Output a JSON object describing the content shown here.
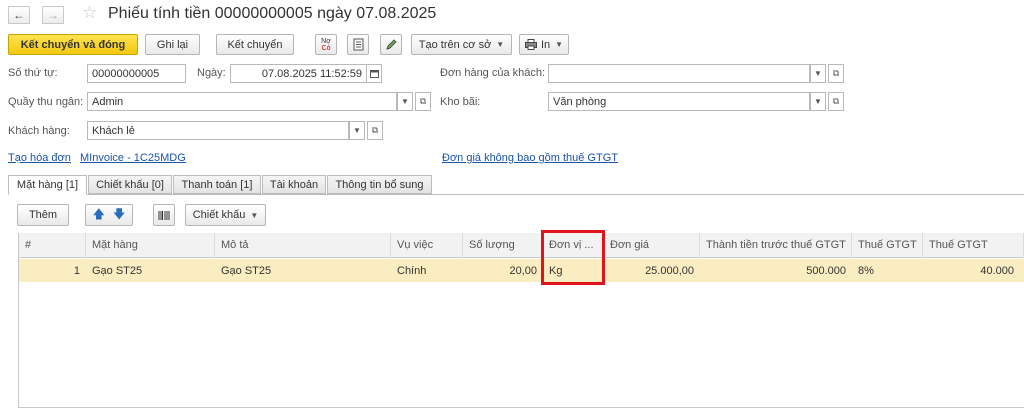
{
  "window": {
    "title": "Phiếu tính tiền 00000000005 ngày 07.08.2025",
    "back_icon": "arrow-left-icon",
    "forward_icon": "arrow-right-icon",
    "favorite_icon": "star-icon"
  },
  "toolbar": {
    "post_close_label": "Kết chuyển và đóng",
    "save_label": "Ghi lại",
    "post_label": "Kết chuyển",
    "create_based_label": "Tạo trên cơ sở",
    "print_label": "In",
    "icon_nc_text": "Nợ",
    "icon_nc_text2": "Có"
  },
  "form": {
    "number_label": "Số thứ tự:",
    "number_value": "00000000005",
    "date_label": "Ngày:",
    "date_value": "07.08.2025 11:52:59",
    "customer_order_label": "Đơn hàng của khách:",
    "customer_order_value": "",
    "cashier_label": "Quầy thu ngân:",
    "cashier_value": "Admin",
    "warehouse_label": "Kho bãi:",
    "warehouse_value": "Văn phòng",
    "customer_label": "Khách hàng:",
    "customer_value": "Khách lẻ",
    "create_invoice_link": "Tạo hóa đơn",
    "minvoice_link": "MInvoice - 1C25MDG",
    "price_vat_link": "Đơn giá không bao gồm thuế GTGT"
  },
  "tabs": [
    {
      "label": "Mặt hàng [1]",
      "active": true
    },
    {
      "label": "Chiết khấu [0]",
      "active": false
    },
    {
      "label": "Thanh toán [1]",
      "active": false
    },
    {
      "label": "Tài khoản",
      "active": false
    },
    {
      "label": "Thông tin bổ sung",
      "active": false
    }
  ],
  "items_toolbar": {
    "add_label": "Thêm",
    "discount_label": "Chiết khấu"
  },
  "table": {
    "columns": [
      "#",
      "Mặt hàng",
      "Mô tả",
      "Vụ việc",
      "Số lượng",
      "Đơn vị ...",
      "Đơn giá",
      "Thành tiền trước thuế GTGT",
      "Thuế GTGT",
      "Thuế GTGT"
    ],
    "rows": [
      [
        "1",
        "Gạo ST25",
        "Gạo ST25",
        "Chính",
        "20,00",
        "Kg",
        "25.000,00",
        "500.000",
        "8%",
        "40.000"
      ]
    ]
  },
  "colors": {
    "primary_button": "#f2c811",
    "selected_row": "#fbedc2",
    "highlight_box": "#e0141b",
    "link": "#1a53a8"
  }
}
